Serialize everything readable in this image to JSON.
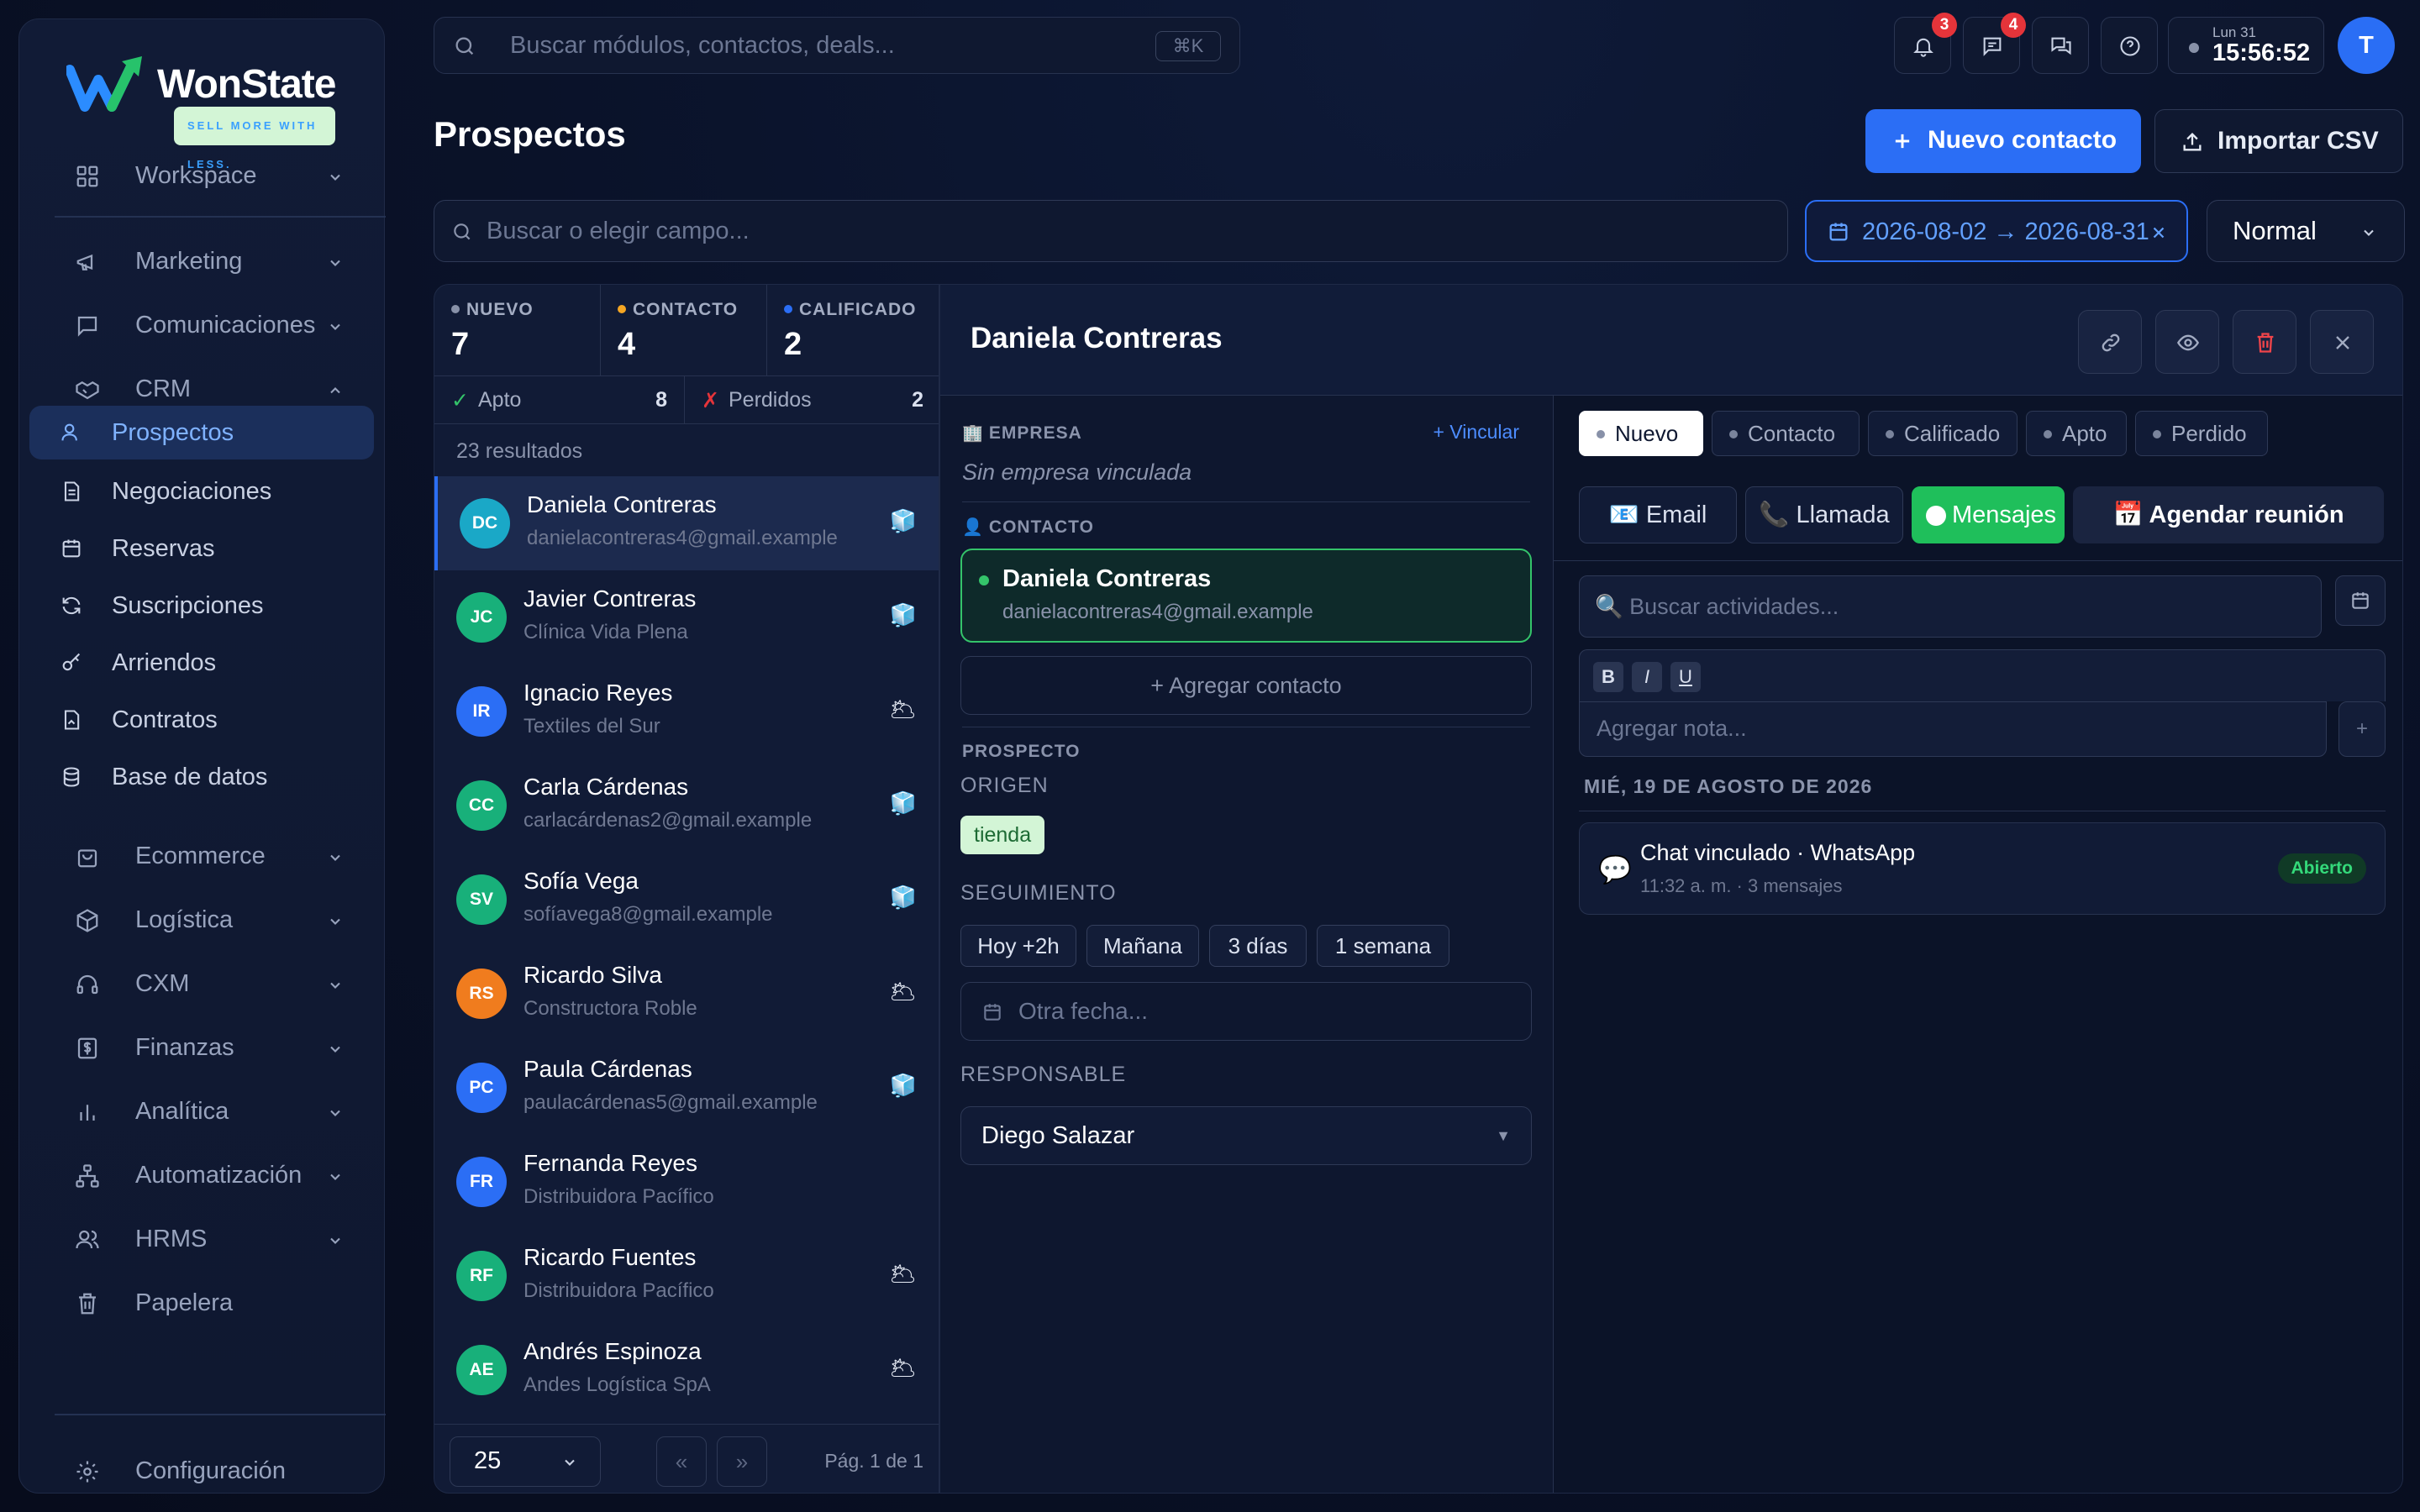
{
  "app": {
    "brand": "WonState",
    "tagline": "SELL MORE WITH LESS."
  },
  "sidebar": {
    "groups_top": [
      {
        "label": "Workspace",
        "icon": "grid-icon"
      }
    ],
    "groups": [
      {
        "label": "Marketing",
        "icon": "megaphone-icon"
      },
      {
        "label": "Comunicaciones",
        "icon": "chat-bubble-icon"
      },
      {
        "label": "CRM",
        "icon": "handshake-icon",
        "expanded": true
      }
    ],
    "crm_items": [
      {
        "label": "Prospectos",
        "icon": "user-icon",
        "active": true
      },
      {
        "label": "Negociaciones",
        "icon": "document-icon"
      },
      {
        "label": "Reservas",
        "icon": "calendar-icon"
      },
      {
        "label": "Suscripciones",
        "icon": "refresh-icon"
      },
      {
        "label": "Arriendos",
        "icon": "key-icon"
      },
      {
        "label": "Contratos",
        "icon": "contract-icon"
      },
      {
        "label": "Base de datos",
        "icon": "database-icon"
      }
    ],
    "groups_bottom": [
      {
        "label": "Ecommerce",
        "icon": "shopping-bag-icon"
      },
      {
        "label": "Logística",
        "icon": "box-icon"
      },
      {
        "label": "CXM",
        "icon": "headset-icon"
      },
      {
        "label": "Finanzas",
        "icon": "dollar-icon"
      },
      {
        "label": "Analítica",
        "icon": "bar-chart-icon"
      },
      {
        "label": "Automatización",
        "icon": "workflow-icon"
      },
      {
        "label": "HRMS",
        "icon": "people-icon"
      },
      {
        "label": "Papelera",
        "icon": "trash-icon"
      }
    ],
    "settings": {
      "label": "Configuración",
      "icon": "gear-icon"
    }
  },
  "topbar": {
    "search_placeholder": "Buscar módulos, contactos, deals...",
    "shortcut": "⌘K",
    "notifications_count": "3",
    "messages_count": "4",
    "clock_date": "Lun 31",
    "clock_time": "15:56:52",
    "avatar_initial": "T"
  },
  "page": {
    "title": "Prospectos",
    "new_contact": "Nuevo contacto",
    "import_csv": "Importar CSV",
    "field_search_placeholder": "Buscar o elegir campo...",
    "date_range": "2026-08-02 → 2026-08-31",
    "view_mode": "Normal"
  },
  "stats": [
    {
      "name": "NUEVO",
      "value": "7",
      "color": "#8891a8"
    },
    {
      "name": "CONTACTO",
      "value": "4",
      "color": "#f5a623"
    },
    {
      "name": "CALIFICADO",
      "value": "2",
      "color": "#2b6ef5"
    }
  ],
  "substats": [
    {
      "label": "Apto",
      "mark": "✓",
      "count": "8",
      "color": "#34c46a"
    },
    {
      "label": "Perdidos",
      "mark": "✗",
      "count": "2",
      "color": "#e5343a"
    }
  ],
  "results_text": "23 resultados",
  "leads": [
    {
      "initials": "DC",
      "name": "Daniela Contreras",
      "sub": "danielacontreras4@gmail.example",
      "temp": "🧊",
      "color": "#1aa8c7",
      "selected": true
    },
    {
      "initials": "JC",
      "name": "Javier Contreras",
      "sub": "Clínica Vida Plena",
      "temp": "🧊",
      "color": "#18b07a"
    },
    {
      "initials": "IR",
      "name": "Ignacio Reyes",
      "sub": "Textiles del Sur",
      "temp": "🌥",
      "color": "#2b6ef5"
    },
    {
      "initials": "CC",
      "name": "Carla Cárdenas",
      "sub": "carlacárdenas2@gmail.example",
      "temp": "🧊",
      "color": "#18b07a"
    },
    {
      "initials": "SV",
      "name": "Sofía Vega",
      "sub": "sofíavega8@gmail.example",
      "temp": "🧊",
      "color": "#18b07a"
    },
    {
      "initials": "RS",
      "name": "Ricardo Silva",
      "sub": "Constructora Roble",
      "temp": "🌥",
      "color": "#f07c1e"
    },
    {
      "initials": "PC",
      "name": "Paula Cárdenas",
      "sub": "paulacárdenas5@gmail.example",
      "temp": "🧊",
      "color": "#2b6ef5"
    },
    {
      "initials": "FR",
      "name": "Fernanda Reyes",
      "sub": "Distribuidora Pacífico",
      "temp": "",
      "color": "#2b6ef5"
    },
    {
      "initials": "RF",
      "name": "Ricardo Fuentes",
      "sub": "Distribuidora Pacífico",
      "temp": "🌥",
      "color": "#18b07a"
    },
    {
      "initials": "AE",
      "name": "Andrés Espinoza",
      "sub": "Andes Logística SpA",
      "temp": "🌥",
      "color": "#18b07a"
    }
  ],
  "pager": {
    "page_size": "25",
    "prev": "«",
    "next": "»",
    "page_text": "Pág. 1 de 1"
  },
  "detail": {
    "name": "Daniela Contreras",
    "company_label": "EMPRESA",
    "link_label": "+ Vincular",
    "company_empty": "Sin empresa vinculada",
    "contact_label": "CONTACTO",
    "contact_name": "Daniela Contreras",
    "contact_email": "danielacontreras4@gmail.example",
    "add_contact": "+ Agregar contacto",
    "prospect_label": "PROSPECTO",
    "origin_label": "ORIGEN",
    "origin_value": "tienda",
    "followup_label": "SEGUIMIENTO",
    "followup_options": [
      "Hoy +2h",
      "Mañana",
      "3 días",
      "1 semana"
    ],
    "other_date": "Otra fecha...",
    "owner_label": "RESPONSABLE",
    "owner_value": "Diego Salazar",
    "stages": [
      "Nuevo",
      "Contacto",
      "Calificado",
      "Apto",
      "Perdido"
    ],
    "actions": [
      "📧 Email",
      "📞 Llamada",
      "Mensajes",
      "📅 Agendar reunión"
    ],
    "activity_search": "🔍 Buscar actividades...",
    "editor": [
      "B",
      "I",
      "U"
    ],
    "note_placeholder": "Agregar nota...",
    "note_add": "+",
    "day_label": "MIÉ, 19 DE AGOSTO DE 2026",
    "activity": {
      "icon": "💬",
      "title": "Chat vinculado · WhatsApp",
      "meta": "11:32 a. m. · 3 mensajes",
      "status": "Abierto"
    }
  }
}
